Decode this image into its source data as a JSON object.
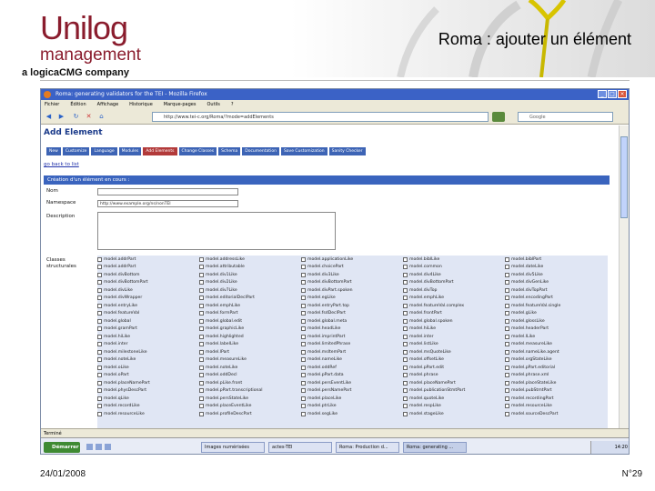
{
  "logo": {
    "brand": "Unilog",
    "sub": "management",
    "tagline": "a logicaCMG company"
  },
  "slide_title": "Roma : ajouter un élément",
  "browser": {
    "window_title": "Roma: generating validators for the TEI - Mozilla Firefox",
    "menu": [
      "Fichier",
      "Édition",
      "Affichage",
      "Historique",
      "Marque-pages",
      "Outils",
      "?"
    ],
    "url": "http://www.tei-c.org/Roma/?mode=addElements",
    "search_placeholder": "Google",
    "status": "Terminé"
  },
  "page": {
    "heading": "Add Element",
    "tabs": [
      "New",
      "Customize",
      "Language",
      "Modules",
      "Add Elements",
      "Change Classes",
      "Schema",
      "Documentation",
      "Save Customization",
      "Sanity Checker"
    ],
    "active_tab": "Add Elements",
    "back_link": "go back to list",
    "form_header": "Création d'un élément en cours :",
    "labels": {
      "name": "Nom",
      "namespace": "Namespace",
      "description": "Description",
      "classes": "Classes structurales"
    },
    "namespace_value": "http://www.example.org/ns/nonTEI",
    "classes": [
      [
        "model.addrPart",
        "model.addrPart",
        "model.divBottom",
        "model.divBottomPart",
        "model.divLike",
        "model.divWrapper",
        "model.entryLike",
        "model.featureVal",
        "model.global",
        "model.gramPart",
        "model.hiLike",
        "model.inter",
        "model.milestoneLike",
        "model.noteLike",
        "model.oLike",
        "model.oPart",
        "model.placeNamePart",
        "model.physDescPart",
        "model.qLike",
        "model.recordLike",
        "model.resourceLike"
      ],
      [
        "model.addressLike",
        "model.attributable",
        "model.div1Like",
        "model.div2Like",
        "model.div7Like",
        "model.editorialDeclPart",
        "model.emphLike",
        "model.formPart",
        "model.global.edit",
        "model.graphicLike",
        "model.highlighted",
        "model.labelLike",
        "model.lPart",
        "model.measureLike",
        "model.noteLike",
        "model.oddDecl",
        "model.pLike.front",
        "model.pPart.transcriptional",
        "model.persStateLike",
        "model.placeEventLike",
        "model.profileDescPart"
      ],
      [
        "model.applicationLike",
        "model.choicePart",
        "model.div3Like",
        "model.divBottomPart",
        "model.divPart.spoken",
        "model.egLike",
        "model.entryPart.top",
        "model.fsdDeclPart",
        "model.global.meta",
        "model.headLike",
        "model.imprintPart",
        "model.limitedPhrase",
        "model.msItemPart",
        "model.nameLike",
        "model.oddRef",
        "model.pPart.data",
        "model.persEventLike",
        "model.persNamePart",
        "model.placeLike",
        "model.ptrLike",
        "model.segLike"
      ],
      [
        "model.biblLike",
        "model.common",
        "model.div4Like",
        "model.divBottomPart",
        "model.divTop",
        "model.emphLike",
        "model.featureVal.complex",
        "model.frontPart",
        "model.global.spoken",
        "model.hiLike",
        "model.inter",
        "model.listLike",
        "model.msQuoteLike",
        "model.offsetLike",
        "model.pPart.edit",
        "model.phrase",
        "model.placeNamePart",
        "model.publicationStmtPart",
        "model.quoteLike",
        "model.respLike",
        "model.stageLike"
      ],
      [
        "model.biblPart",
        "model.dateLike",
        "model.div5Like",
        "model.divGenLike",
        "model.divTopPart",
        "model.encodingPart",
        "model.featureVal.single",
        "model.gLike",
        "model.glossLike",
        "model.headerPart",
        "model.lLike",
        "model.measureLike",
        "model.nameLike.agent",
        "model.orgStateLike",
        "model.pPart.editorial",
        "model.phrase.xml",
        "model.placeStateLike",
        "model.pubStmtPart",
        "model.recordingPart",
        "model.resourceLike",
        "model.sourceDescPart"
      ]
    ]
  },
  "taskbar": {
    "start": "Démarrer",
    "tasks": [
      "Images numérisées",
      "actes-TEI",
      "Roma: Production d...",
      "Roma: generating ..."
    ],
    "active_task": "Roma: generating ...",
    "clock": "14:20"
  },
  "footer": {
    "date": "24/01/2008",
    "page": "N°29"
  },
  "colors": {
    "brand": "#8a1c2d",
    "tab_bg": "#3d64b5",
    "active_tab_bg": "#b23a3a",
    "form_header_bg": "#3a64be",
    "titlebar": "#3b62c6"
  }
}
